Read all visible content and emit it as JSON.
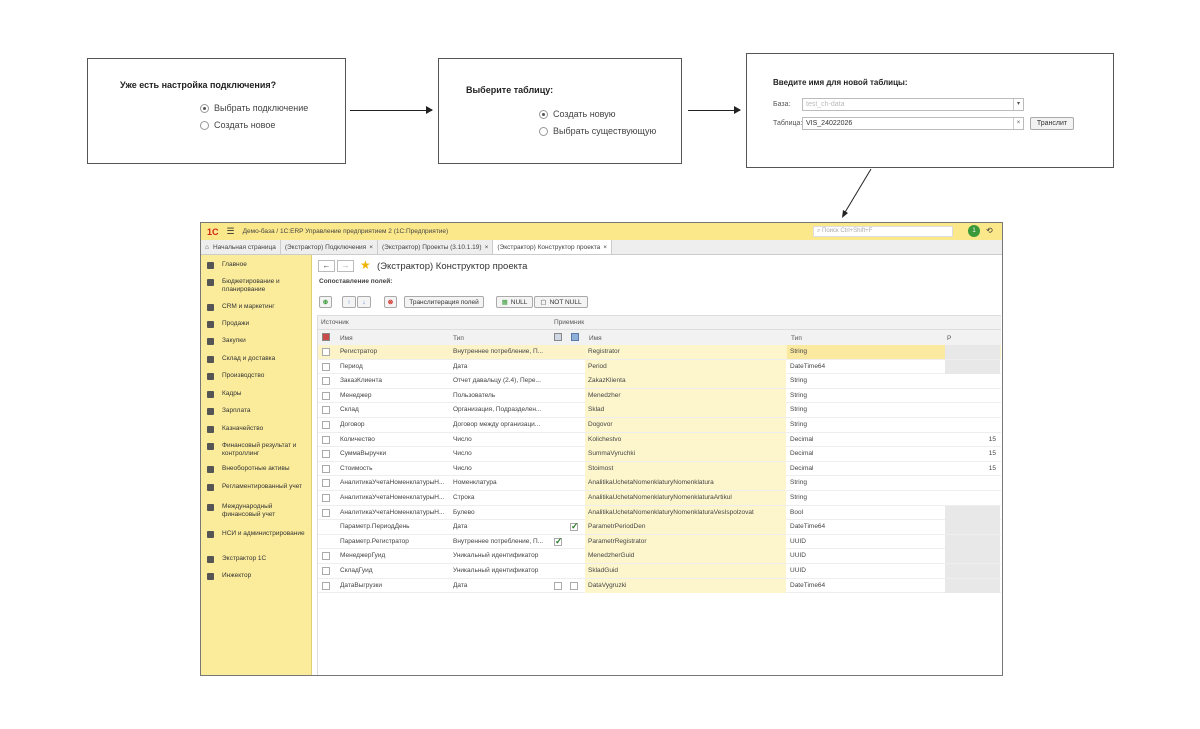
{
  "step1": {
    "question": "Уже есть настройка подключения?",
    "options": [
      "Выбрать подключение",
      "Создать новое"
    ]
  },
  "step2": {
    "question": "Выберите таблицу:",
    "options": [
      "Создать новую",
      "Выбрать существующую"
    ]
  },
  "step3": {
    "question": "Введите имя для новой таблицы:",
    "base_label": "База:",
    "base_value": "test_ch-data",
    "table_label": "Таблица:",
    "table_value": "VIS_24022026",
    "translit_button": "Транслит"
  },
  "app": {
    "title": "Демо-база / 1С:ERP Управление предприятием 2  (1С:Предприятие)",
    "search_placeholder": "Поиск Ctrl+Shift+F",
    "notification_count": "1",
    "tabs": [
      "Начальная страница",
      "(Экстрактор) Подключения",
      "(Экстрактор) Проекты (3.10.1.19)",
      "(Экстрактор) Конструктор проекта"
    ],
    "sidebar": [
      "Главное",
      "Бюджетирование и планирование",
      "CRM и маркетинг",
      "Продажи",
      "Закупки",
      "Склад и доставка",
      "Производство",
      "Кадры",
      "Зарплата",
      "Казначейство",
      "Финансовый результат и контроллинг",
      "Внеоборотные активы",
      "Регламентированный учет",
      "Международный финансовый учет",
      "НСИ и администрирование",
      "Экстрактор 1С",
      "Инжектор"
    ],
    "page_title": "(Экстрактор) Конструктор проекта",
    "section_title": "Сопоставление полей:",
    "toolbar": {
      "translit": "Транслитерация полей",
      "null": "NULL",
      "not_null": "NOT NULL"
    },
    "group_source": "Источник",
    "group_target": "Приемник",
    "col_name": "Имя",
    "col_type": "Тип",
    "col_name2": "Имя",
    "col_type2": "Тип",
    "col_p": "Р"
  },
  "rows": [
    {
      "src": "Регистратор",
      "stype": "Внутреннее потребление, П...",
      "dst": "Registrator",
      "dtype": "String",
      "p": ""
    },
    {
      "src": "Период",
      "stype": "Дата",
      "dst": "Period",
      "dtype": "DateTime64",
      "p": ""
    },
    {
      "src": "ЗаказКлиента",
      "stype": "Отчет давальцу (2.4), Пере...",
      "dst": "ZakazKlienta",
      "dtype": "String",
      "p": ""
    },
    {
      "src": "Менеджер",
      "stype": "Пользователь",
      "dst": "Menedzher",
      "dtype": "String",
      "p": ""
    },
    {
      "src": "Склад",
      "stype": "Организация, Подразделен...",
      "dst": "Sklad",
      "dtype": "String",
      "p": ""
    },
    {
      "src": "Договор",
      "stype": "Договор между организаци...",
      "dst": "Dogovor",
      "dtype": "String",
      "p": ""
    },
    {
      "src": "Количество",
      "stype": "Число",
      "dst": "Kolichestvo",
      "dtype": "Decimal",
      "p": "15"
    },
    {
      "src": "СуммаВыручки",
      "stype": "Число",
      "dst": "SummaVyruchki",
      "dtype": "Decimal",
      "p": "15"
    },
    {
      "src": "Стоимость",
      "stype": "Число",
      "dst": "Stoimost",
      "dtype": "Decimal",
      "p": "15"
    },
    {
      "src": "АналитикаУчетаНоменклатурыН...",
      "stype": "Номенклатура",
      "dst": "AnalitikaUchetaNomenklaturyNomenklatura",
      "dtype": "String",
      "p": ""
    },
    {
      "src": "АналитикаУчетаНоменклатурыН...",
      "stype": "Строка",
      "dst": "AnalitikaUchetaNomenklaturyNomenklaturaArtikul",
      "dtype": "String",
      "p": ""
    },
    {
      "src": "АналитикаУчетаНоменклатурыН...",
      "stype": "Булево",
      "dst": "AnalitikaUchetaNomenklaturyNomenklaturaVesIspolzovat",
      "dtype": "Bool",
      "p": ""
    },
    {
      "src": "Параметр.ПериодДень",
      "stype": "Дата",
      "dst": "ParametrPeriodDen",
      "dtype": "DateTime64",
      "p": ""
    },
    {
      "src": "Параметр.Регистратор",
      "stype": "Внутреннее потребление, П...",
      "dst": "ParametrRegistrator",
      "dtype": "UUID",
      "p": ""
    },
    {
      "src": "МенеджерГуид",
      "stype": "Уникальный идентификатор",
      "dst": "MenedzherGuid",
      "dtype": "UUID",
      "p": ""
    },
    {
      "src": "СкладГуид",
      "stype": "Уникальный идентификатор",
      "dst": "SkladGuid",
      "dtype": "UUID",
      "p": ""
    },
    {
      "src": "ДатаВыгрузки",
      "stype": "Дата",
      "dst": "DataVygruzki",
      "dtype": "DateTime64",
      "p": ""
    }
  ]
}
